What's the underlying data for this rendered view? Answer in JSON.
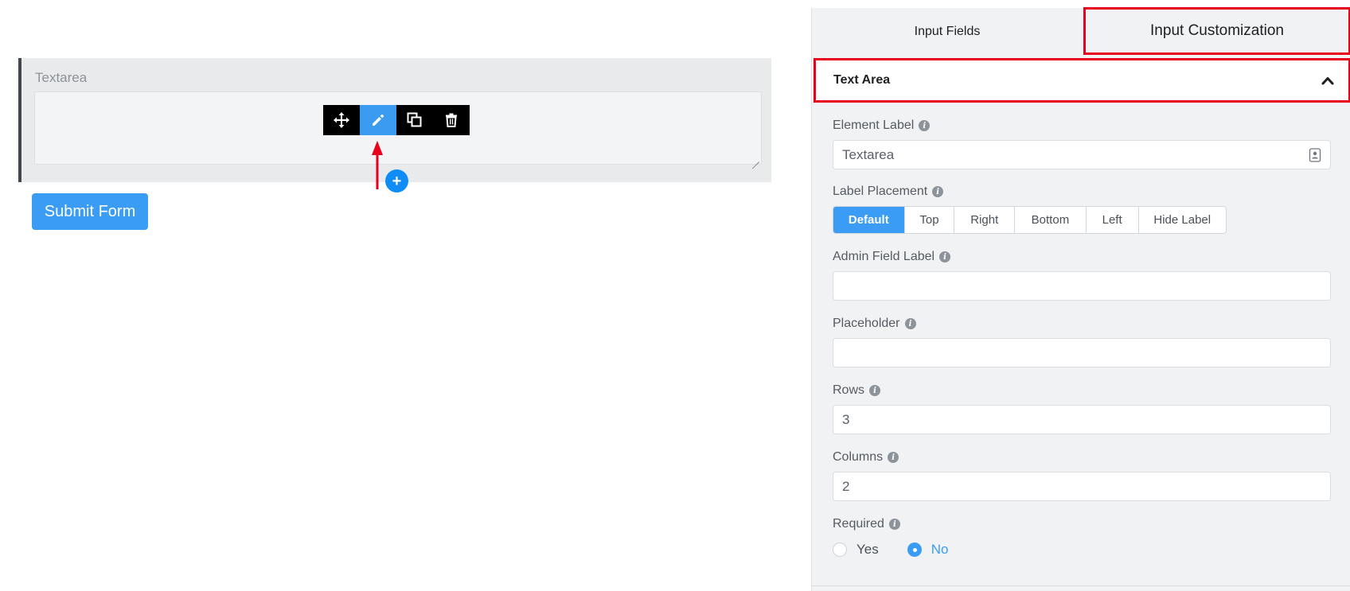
{
  "canvas": {
    "field_label": "Textarea",
    "toolbar": {
      "move_icon": "move-icon",
      "edit_icon": "pencil-icon",
      "duplicate_icon": "copy-icon",
      "delete_icon": "trash-icon"
    },
    "add_icon": "+",
    "submit_label": "Submit Form"
  },
  "panel": {
    "tabs": [
      {
        "label": "Input Fields",
        "active": false
      },
      {
        "label": "Input Customization",
        "active": true
      }
    ],
    "section_title": "Text Area",
    "element_label": {
      "label": "Element Label",
      "value": "Textarea"
    },
    "label_placement": {
      "label": "Label Placement",
      "options": [
        "Default",
        "Top",
        "Right",
        "Bottom",
        "Left",
        "Hide Label"
      ],
      "selected": "Default"
    },
    "admin_field_label": {
      "label": "Admin Field Label",
      "value": ""
    },
    "placeholder": {
      "label": "Placeholder",
      "value": ""
    },
    "rows": {
      "label": "Rows",
      "value": "3"
    },
    "columns": {
      "label": "Columns",
      "value": "2"
    },
    "required": {
      "label": "Required",
      "options": [
        "Yes",
        "No"
      ],
      "selected": "No"
    }
  },
  "colors": {
    "accent": "#3a9cf5",
    "highlight": "#e8001c",
    "toolbar_bg": "#000000"
  }
}
